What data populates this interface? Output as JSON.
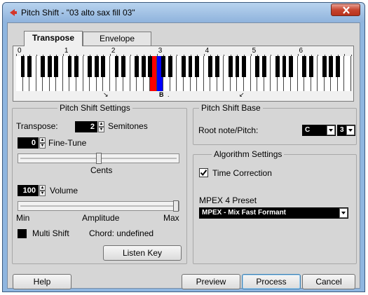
{
  "window": {
    "title": "Pitch Shift - \"03 alto sax fill 03\"",
    "close_icon": "close-x-icon",
    "app_icon": "cubase-icon"
  },
  "tabs": [
    {
      "label": "Transpose",
      "active": true
    },
    {
      "label": "Envelope",
      "active": false
    }
  ],
  "keyboard": {
    "octave_labels": [
      "0",
      "1",
      "2",
      "3",
      "4",
      "5",
      "6"
    ],
    "root_marker": "B",
    "root_color": "#ff0000",
    "target_color": "#0000ff"
  },
  "pitch_shift_settings": {
    "legend": "Pitch Shift Settings",
    "transpose_label": "Transpose:",
    "transpose_value": "2",
    "semitones_label": "Semitones",
    "finetune_value": "0",
    "finetune_label": "Fine-Tune",
    "cents_label": "Cents",
    "finetune_level": 0.5,
    "volume_value": "100",
    "volume_label": "Volume",
    "amplitude_min": "Min",
    "amplitude_label": "Amplitude",
    "amplitude_max": "Max",
    "volume_level": 1.0,
    "multi_shift_label": "Multi Shift",
    "multi_shift_checked": false,
    "chord_label": "Chord: undefined",
    "listen_key_label": "Listen Key"
  },
  "pitch_shift_base": {
    "legend": "Pitch Shift Base",
    "root_note_label": "Root note/Pitch:",
    "root_note_value": "C",
    "root_octave_value": "3"
  },
  "algorithm_settings": {
    "legend": "Algorithm Settings",
    "time_correction_label": "Time Correction",
    "time_correction_checked": true,
    "preset_label": "MPEX 4 Preset",
    "preset_value": "MPEX - Mix Fast Formant"
  },
  "buttons": {
    "help": "Help",
    "preview": "Preview",
    "process": "Process",
    "cancel": "Cancel"
  }
}
